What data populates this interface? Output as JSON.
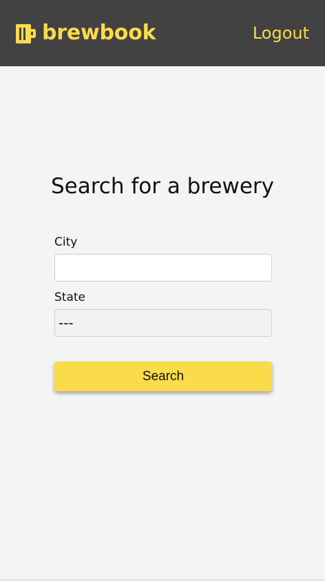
{
  "navbar": {
    "brand_name": "brewbook",
    "brand_icon": "beer-mug-icon",
    "logout_label": "Logout",
    "background_color": "#424242",
    "accent_color": "#fadb4a"
  },
  "main": {
    "heading": "Search for a brewery",
    "city": {
      "label": "City",
      "value": ""
    },
    "state": {
      "label": "State",
      "selected": "---"
    },
    "search_button_label": "Search",
    "background_color": "#f4f4f4"
  }
}
